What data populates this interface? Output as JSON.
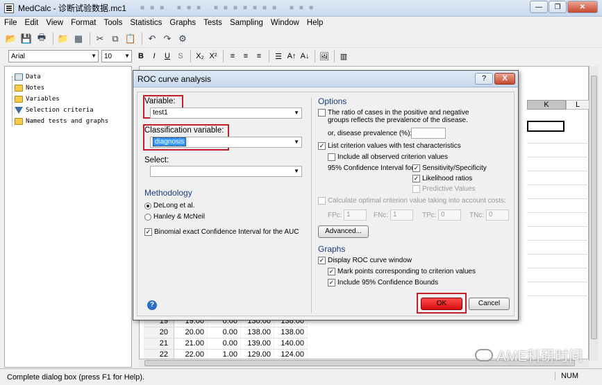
{
  "window": {
    "title": "MedCalc - 诊断试验数据.mc1",
    "blurred_tabs": "■■■  ■■■  ■■■■■■■  ■■■"
  },
  "menu": [
    "File",
    "Edit",
    "View",
    "Format",
    "Tools",
    "Statistics",
    "Graphs",
    "Tests",
    "Sampling",
    "Window",
    "Help"
  ],
  "format_bar": {
    "font": "Arial",
    "size": "10",
    "bold": "B",
    "italic": "I",
    "underline": "U",
    "strike": "S",
    "subscript": "X₂",
    "superscript": "X²",
    "grow": "A↑",
    "shrink": "A↓"
  },
  "tree": {
    "items": [
      "Data",
      "Notes",
      "Variables",
      "Selection criteria",
      "Named tests and graphs"
    ]
  },
  "sheet": {
    "col_k": "K",
    "col_l": "L",
    "rows": [
      {
        "n": "19",
        "a": "19.00",
        "b": "0.00",
        "c": "130.00",
        "d": "138.00"
      },
      {
        "n": "20",
        "a": "20.00",
        "b": "0.00",
        "c": "138.00",
        "d": "138.00"
      },
      {
        "n": "21",
        "a": "21.00",
        "b": "0.00",
        "c": "139.00",
        "d": "140.00"
      },
      {
        "n": "22",
        "a": "22.00",
        "b": "1.00",
        "c": "129.00",
        "d": "124.00"
      }
    ]
  },
  "status": {
    "text": "Complete dialog box (press F1 for Help).",
    "num": "NUM"
  },
  "watermark": "AME科研时间",
  "dialog": {
    "title": "ROC curve analysis",
    "help_label": "?",
    "close_label": "X",
    "variable_label": "Variable:",
    "variable_value": "test1",
    "class_label": "Classification variable:",
    "class_value": "diagnosis",
    "select_label": "Select:",
    "select_value": "",
    "methodology_label": "Methodology",
    "method_delong": "DeLong et al.",
    "method_hanley": "Hanley & McNeil",
    "binomial_label": "Binomial exact Confidence Interval for the AUC",
    "options_label": "Options",
    "ratio_label_1": "The ratio of cases in the positive and negative",
    "ratio_label_2": "groups reflects the prevalence of the disease.",
    "prevalence_label": "or, disease prevalence (%):",
    "prevalence_value": "",
    "list_criterion_label": "List criterion values with test characteristics",
    "include_all_label": "Include all observed criterion values",
    "ci_label": "95% Confidence Interval for:",
    "sens_spec_label": "Sensitivity/Specificity",
    "likelihood_label": "Likelihood ratios",
    "predictive_label": "Predictive Values",
    "optimal_label": "Calculate optimal criterion value taking into account costs:",
    "fpc_label": "FPc:",
    "fpc_value": "1",
    "fnc_label": "FNc:",
    "fnc_value": "1",
    "tpc_label": "TPc:",
    "tpc_value": "0",
    "tnc_label": "TNc:",
    "tnc_value": "0",
    "advanced_label": "Advanced...",
    "graphs_label": "Graphs",
    "display_roc_label": "Display ROC curve window",
    "mark_points_label": "Mark points corresponding to criterion values",
    "include_bounds_label": "Include 95% Confidence Bounds",
    "ok_label": "OK",
    "cancel_label": "Cancel",
    "help_icon": "?",
    "check_mark": "✓"
  },
  "colors": {
    "highlight_red": "#c0202a",
    "ok_red": "#e02020",
    "section_blue": "#1a3d7a"
  }
}
